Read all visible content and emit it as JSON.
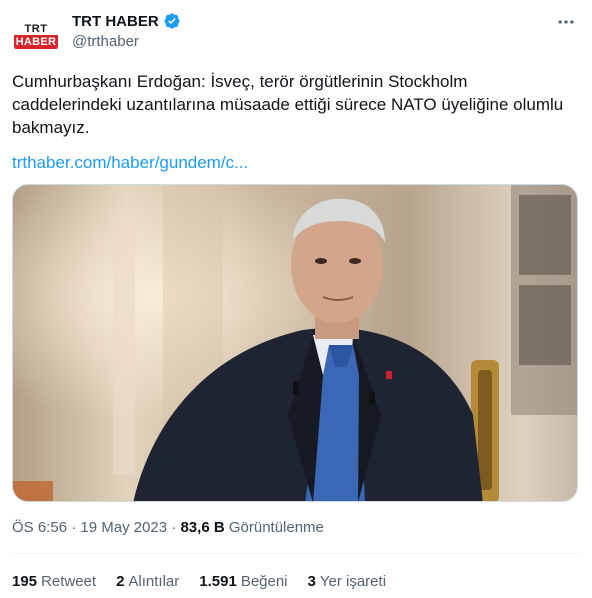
{
  "author": {
    "display_name": "TRT HABER",
    "handle": "@trthaber",
    "avatar_top": "TRT",
    "avatar_bottom": "HABER",
    "verified_color": "#1d9bf0"
  },
  "tweet": {
    "text": "Cumhurbaşkanı Erdoğan: İsveç, terör örgütlerinin Stockholm\ncaddelerindeki uzantılarına müsaade ettiği sürece NATO üyeliğine olumlu\nbakmayız.",
    "link": "trthaber.com/haber/gundem/c...",
    "time": "ÖS 6:56",
    "date": "19 May 2023",
    "views_count": "83,6 B",
    "views_label": "Görüntülenme"
  },
  "stats": [
    {
      "count": "195",
      "label": "Retweet"
    },
    {
      "count": "2",
      "label": "Alıntılar"
    },
    {
      "count": "1.591",
      "label": "Beğeni"
    },
    {
      "count": "3",
      "label": "Yer işareti"
    }
  ],
  "icons": {
    "more": "more-horizontal-icon",
    "verified": "verified-badge-icon"
  },
  "colors": {
    "link": "#1d9bf0",
    "secondary_text": "#536471",
    "brand_red": "#d8232a"
  }
}
